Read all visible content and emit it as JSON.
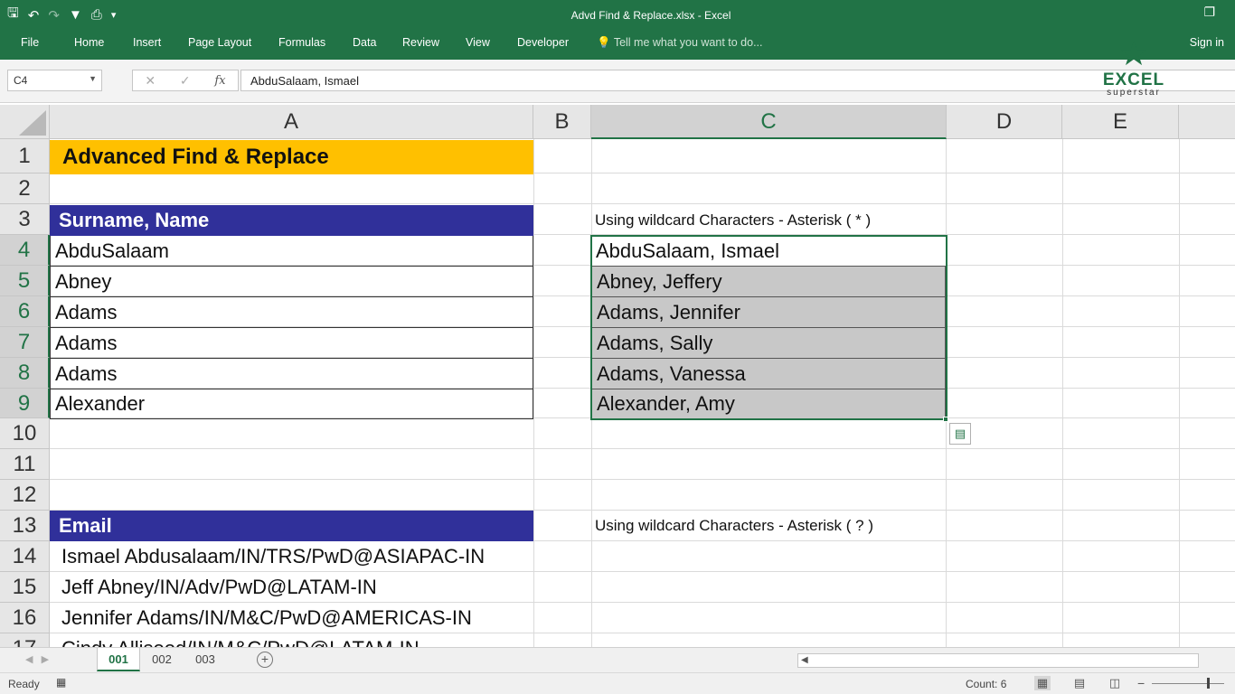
{
  "window": {
    "title": "Advd Find & Replace.xlsx - Excel",
    "restore_icon": "restore-icon"
  },
  "qat": {
    "icons": [
      "save-icon",
      "undo-icon",
      "redo-icon",
      "filter-icon",
      "print-preview-icon",
      "customize-icon"
    ]
  },
  "ribbon": {
    "tabs": [
      "File",
      "Home",
      "Insert",
      "Page Layout",
      "Formulas",
      "Data",
      "Review",
      "View",
      "Developer"
    ],
    "tell_me": "Tell me what you want to do...",
    "sign_in": "Sign in"
  },
  "formula_bar": {
    "name_box": "C4",
    "fx": "fx",
    "content": "AbduSalaam, Ismael"
  },
  "logo": {
    "line1": "EXCEL",
    "line2": "superstar"
  },
  "columns": [
    "A",
    "B",
    "C",
    "D",
    "E"
  ],
  "selected_column": "C",
  "rows": [
    "1",
    "2",
    "3",
    "4",
    "5",
    "6",
    "7",
    "8",
    "9",
    "10",
    "11",
    "12",
    "13",
    "14",
    "15",
    "16",
    "17"
  ],
  "cells": {
    "A1": "Advanced Find & Replace",
    "A3": "Surname, Name",
    "A4": "AbduSalaam",
    "A5": "Abney",
    "A6": "Adams",
    "A7": "Adams",
    "A8": "Adams",
    "A9": "Alexander",
    "A13": "Email",
    "A14": "Ismael Abdusalaam/IN/TRS/PwD@ASIAPAC-IN",
    "A15": "Jeff Abney/IN/Adv/PwD@LATAM-IN",
    "A16": "Jennifer Adams/IN/M&C/PwD@AMERICAS-IN",
    "A17": "Cindy Allisood/IN/M&C/PwD@LATAM-IN",
    "C3": "Using wildcard Characters - Asterisk ( * )",
    "C4": "AbduSalaam, Ismael",
    "C5": "Abney, Jeffery",
    "C6": "Adams, Jennifer",
    "C7": "Adams, Sally",
    "C8": "Adams, Vanessa",
    "C9": "Alexander, Amy",
    "C13": "Using wildcard Characters - Asterisk ( ? )"
  },
  "colors": {
    "accent": "#217346",
    "title_fill": "#ffc000",
    "header_fill": "#30309a",
    "selection_fill": "#c8c8c8"
  },
  "sheets": {
    "tabs": [
      "001",
      "002",
      "003"
    ],
    "active": "001"
  },
  "status": {
    "ready": "Ready",
    "count": "Count: 6"
  }
}
